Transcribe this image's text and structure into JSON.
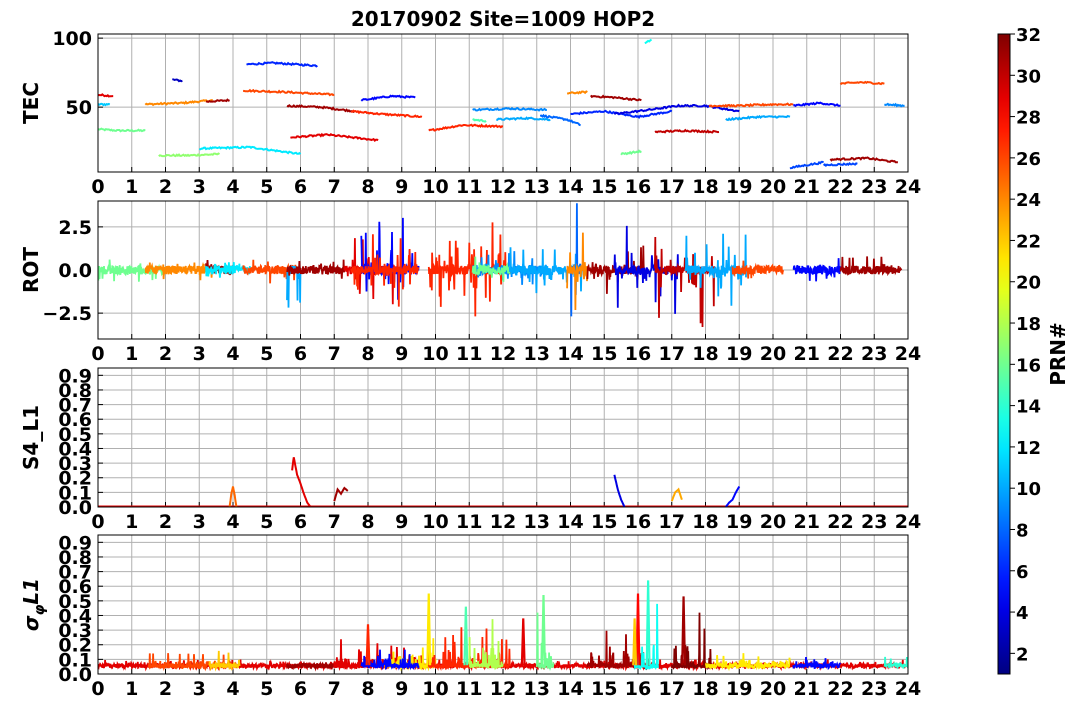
{
  "title": "20170902 Site=1009 HOP2",
  "xticks": [
    "0",
    "1",
    "2",
    "3",
    "4",
    "5",
    "6",
    "7",
    "8",
    "9",
    "10",
    "11",
    "12",
    "13",
    "14",
    "15",
    "16",
    "17",
    "18",
    "19",
    "20",
    "21",
    "22",
    "23",
    "24"
  ],
  "colorbar": {
    "label": "PRN#",
    "ticks": [
      "2",
      "4",
      "6",
      "8",
      "10",
      "12",
      "14",
      "16",
      "18",
      "20",
      "22",
      "24",
      "26",
      "28",
      "30",
      "32"
    ],
    "range": [
      1,
      32
    ]
  },
  "chart_data": [
    {
      "type": "line",
      "ylabel": "TEC",
      "xlim": [
        0,
        24
      ],
      "ylim": [
        3,
        103
      ],
      "yticks": [
        "50",
        "100"
      ],
      "ytick_values": [
        50,
        100
      ],
      "grid": true,
      "series": [
        {
          "prn": 16,
          "x": [
            0.0,
            0.6,
            1.4
          ],
          "y": [
            34,
            33,
            33
          ]
        },
        {
          "prn": 11,
          "x": [
            0.0,
            0.35
          ],
          "y": [
            52,
            52
          ]
        },
        {
          "prn": 29,
          "x": [
            0.0,
            0.45
          ],
          "y": [
            59,
            58
          ]
        },
        {
          "prn": 24,
          "x": [
            1.4,
            2.5,
            3.4
          ],
          "y": [
            52,
            53,
            55
          ]
        },
        {
          "prn": 3,
          "x": [
            2.2,
            2.5
          ],
          "y": [
            70,
            69
          ]
        },
        {
          "prn": 31,
          "x": [
            3.2,
            3.9
          ],
          "y": [
            54,
            55
          ]
        },
        {
          "prn": 17,
          "x": [
            1.8,
            2.7,
            3.6
          ],
          "y": [
            15,
            15,
            16
          ]
        },
        {
          "prn": 12,
          "x": [
            3.0,
            4.5,
            6.0
          ],
          "y": [
            20,
            21,
            16
          ]
        },
        {
          "prn": 6,
          "x": [
            4.4,
            5.2,
            6.5
          ],
          "y": [
            81,
            82,
            80
          ]
        },
        {
          "prn": 26,
          "x": [
            4.3,
            5.5,
            7.0
          ],
          "y": [
            62,
            61,
            59
          ]
        },
        {
          "prn": 31,
          "x": [
            5.6,
            6.6,
            7.6
          ],
          "y": [
            51,
            50,
            47
          ]
        },
        {
          "prn": 27,
          "x": [
            7.5,
            8.4,
            9.6
          ],
          "y": [
            47,
            45,
            43
          ]
        },
        {
          "prn": 29,
          "x": [
            5.7,
            6.8,
            8.3
          ],
          "y": [
            28,
            30,
            26
          ]
        },
        {
          "prn": 5,
          "x": [
            7.8,
            8.7,
            9.4
          ],
          "y": [
            55,
            58,
            57
          ]
        },
        {
          "prn": 27,
          "x": [
            9.8,
            10.8,
            12.0
          ],
          "y": [
            33,
            37,
            36
          ]
        },
        {
          "prn": 9,
          "x": [
            11.1,
            12.2,
            13.3
          ],
          "y": [
            48,
            49,
            48
          ]
        },
        {
          "prn": 15,
          "x": [
            11.1,
            11.5
          ],
          "y": [
            41,
            40
          ]
        },
        {
          "prn": 10,
          "x": [
            11.8,
            12.7,
            13.4
          ],
          "y": [
            41,
            42,
            41
          ]
        },
        {
          "prn": 8,
          "x": [
            13.1,
            13.9,
            14.3
          ],
          "y": [
            44,
            41,
            37
          ]
        },
        {
          "prn": 24,
          "x": [
            13.9,
            14.5
          ],
          "y": [
            60,
            61
          ]
        },
        {
          "prn": 31,
          "x": [
            14.6,
            15.3,
            16.1
          ],
          "y": [
            58,
            57,
            55
          ]
        },
        {
          "prn": 6,
          "x": [
            14.0,
            15.0,
            16.0,
            17.0
          ],
          "y": [
            45,
            47,
            43,
            47
          ]
        },
        {
          "prn": 4,
          "x": [
            15.3,
            16.3,
            17.2,
            18.0,
            19.0
          ],
          "y": [
            45,
            48,
            51,
            51,
            47
          ]
        },
        {
          "prn": 16,
          "x": [
            15.5,
            16.1
          ],
          "y": [
            16,
            18
          ]
        },
        {
          "prn": 13,
          "x": [
            16.2,
            16.4
          ],
          "y": [
            96,
            99
          ]
        },
        {
          "prn": 30,
          "x": [
            16.5,
            17.4,
            18.4
          ],
          "y": [
            32,
            33,
            32
          ]
        },
        {
          "prn": 26,
          "x": [
            18.1,
            19.0,
            20.0,
            20.6
          ],
          "y": [
            51,
            51,
            52,
            52
          ]
        },
        {
          "prn": 10,
          "x": [
            18.6,
            19.6,
            20.5
          ],
          "y": [
            41,
            43,
            43
          ]
        },
        {
          "prn": 5,
          "x": [
            20.6,
            21.4,
            22.0
          ],
          "y": [
            51,
            53,
            51
          ]
        },
        {
          "prn": 26,
          "x": [
            22.0,
            22.6,
            23.3
          ],
          "y": [
            67,
            68,
            67
          ]
        },
        {
          "prn": 9,
          "x": [
            23.3,
            23.9
          ],
          "y": [
            52,
            51
          ]
        },
        {
          "prn": 7,
          "x": [
            20.5,
            21.0,
            21.5
          ],
          "y": [
            6,
            8,
            10
          ]
        },
        {
          "prn": 7,
          "x": [
            21.5,
            22.5
          ],
          "y": [
            8,
            9
          ]
        },
        {
          "prn": 31,
          "x": [
            21.7,
            22.8,
            23.7
          ],
          "y": [
            12,
            13,
            10
          ]
        }
      ]
    },
    {
      "type": "line",
      "ylabel": "ROT",
      "xlim": [
        0,
        24
      ],
      "ylim": [
        -4,
        4
      ],
      "yticks": [
        "−2.5",
        "0.0",
        "2.5"
      ],
      "ytick_values": [
        -2.5,
        0,
        2.5
      ],
      "grid": true,
      "segments": [
        {
          "prn": 16,
          "start": 0.0,
          "end": 2.0,
          "amp": 0.7
        },
        {
          "prn": 24,
          "start": 1.4,
          "end": 3.4,
          "amp": 0.6
        },
        {
          "prn": 31,
          "start": 3.2,
          "end": 4.0,
          "amp": 0.6
        },
        {
          "prn": 12,
          "start": 3.2,
          "end": 4.5,
          "amp": 0.5
        },
        {
          "prn": 26,
          "start": 4.3,
          "end": 6.0,
          "amp": 0.8
        },
        {
          "prn": 10,
          "start": 5.6,
          "end": 6.0,
          "amp": 2.2
        },
        {
          "prn": 31,
          "start": 5.6,
          "end": 7.3,
          "amp": 0.6
        },
        {
          "prn": 29,
          "start": 7.3,
          "end": 8.8,
          "amp": 2.0
        },
        {
          "prn": 5,
          "start": 7.8,
          "end": 9.5,
          "amp": 3.3
        },
        {
          "prn": 27,
          "start": 7.5,
          "end": 9.5,
          "amp": 2.4
        },
        {
          "prn": 27,
          "start": 9.8,
          "end": 12.2,
          "amp": 3.0
        },
        {
          "prn": 9,
          "start": 11.1,
          "end": 13.3,
          "amp": 1.1
        },
        {
          "prn": 16,
          "start": 11.1,
          "end": 12.2,
          "amp": 0.8
        },
        {
          "prn": 10,
          "start": 12.2,
          "end": 14.4,
          "amp": 1.4
        },
        {
          "prn": 8,
          "start": 14.0,
          "end": 14.3,
          "amp": 4.0
        },
        {
          "prn": 24,
          "start": 13.9,
          "end": 14.5,
          "amp": 2.8
        },
        {
          "prn": 31,
          "start": 14.5,
          "end": 16.2,
          "amp": 1.5
        },
        {
          "prn": 4,
          "start": 15.3,
          "end": 17.2,
          "amp": 2.7
        },
        {
          "prn": 30,
          "start": 16.5,
          "end": 18.3,
          "amp": 3.5
        },
        {
          "prn": 10,
          "start": 17.4,
          "end": 19.2,
          "amp": 2.3
        },
        {
          "prn": 26,
          "start": 18.8,
          "end": 20.3,
          "amp": 0.6
        },
        {
          "prn": 5,
          "start": 20.6,
          "end": 22.0,
          "amp": 0.7
        },
        {
          "prn": 31,
          "start": 22.0,
          "end": 23.8,
          "amp": 0.8
        }
      ]
    },
    {
      "type": "line",
      "ylabel": "S4_L1",
      "xlim": [
        0,
        24
      ],
      "ylim": [
        0,
        0.95
      ],
      "yticks": [
        "0.0",
        "0.1",
        "0.2",
        "0.3",
        "0.4",
        "0.5",
        "0.6",
        "0.7",
        "0.8",
        "0.9"
      ],
      "ytick_values": [
        0.0,
        0.1,
        0.2,
        0.3,
        0.4,
        0.5,
        0.6,
        0.7,
        0.8,
        0.9
      ],
      "grid": true,
      "baseline_prn": 29,
      "series": [
        {
          "prn": 25,
          "x": [
            3.9,
            3.95,
            4.0,
            4.05,
            4.1
          ],
          "y": [
            0.0,
            0.09,
            0.14,
            0.08,
            0.0
          ]
        },
        {
          "prn": 29,
          "x": [
            5.75,
            5.8,
            5.9,
            6.0,
            6.1,
            6.2,
            6.3
          ],
          "y": [
            0.25,
            0.34,
            0.22,
            0.16,
            0.09,
            0.03,
            0.0
          ]
        },
        {
          "prn": 31,
          "x": [
            7.0,
            7.1,
            7.2,
            7.3,
            7.4
          ],
          "y": [
            0.04,
            0.12,
            0.09,
            0.13,
            0.11
          ]
        },
        {
          "prn": 4,
          "x": [
            15.3,
            15.4,
            15.5,
            15.6
          ],
          "y": [
            0.22,
            0.12,
            0.05,
            0.0
          ]
        },
        {
          "prn": 23,
          "x": [
            17.0,
            17.1,
            17.2,
            17.3
          ],
          "y": [
            0.04,
            0.1,
            0.12,
            0.05
          ]
        },
        {
          "prn": 5,
          "x": [
            18.6,
            18.7,
            18.8,
            18.9,
            19.0
          ],
          "y": [
            0.0,
            0.03,
            0.05,
            0.1,
            0.14
          ]
        }
      ]
    },
    {
      "type": "line",
      "ylabel": "σφL1",
      "ylabel_main": "σ",
      "ylabel_sub": "φ",
      "ylabel_tail": "L1",
      "xlim": [
        0,
        24
      ],
      "ylim": [
        0,
        0.95
      ],
      "yticks": [
        "0.0",
        "0.1",
        "0.2",
        "0.3",
        "0.4",
        "0.5",
        "0.6",
        "0.7",
        "0.8",
        "0.9"
      ],
      "ytick_values": [
        0.0,
        0.1,
        0.2,
        0.3,
        0.4,
        0.5,
        0.6,
        0.7,
        0.8,
        0.9
      ],
      "grid": true,
      "segments": [
        {
          "prn": 29,
          "start": 0.0,
          "end": 24.0,
          "amp": 0.05
        },
        {
          "prn": 26,
          "start": 1.5,
          "end": 4.0,
          "amp": 0.1
        },
        {
          "prn": 22,
          "start": 3.3,
          "end": 4.2,
          "amp": 0.12
        },
        {
          "prn": 31,
          "start": 5.6,
          "end": 7.0,
          "amp": 0.06
        },
        {
          "prn": 29,
          "start": 7.0,
          "end": 9.8,
          "amp": 0.2
        },
        {
          "prn": 21,
          "start": 8.5,
          "end": 10.0,
          "amp": 0.2
        },
        {
          "prn": 5,
          "start": 7.8,
          "end": 9.5,
          "amp": 0.14
        },
        {
          "prn": 27,
          "start": 9.8,
          "end": 12.2,
          "amp": 0.28
        },
        {
          "prn": 18,
          "start": 11.0,
          "end": 12.0,
          "amp": 0.35
        },
        {
          "prn": 16,
          "start": 13.0,
          "end": 13.5,
          "amp": 0.4
        },
        {
          "prn": 31,
          "start": 14.5,
          "end": 16.3,
          "amp": 0.25
        },
        {
          "prn": 13,
          "start": 15.9,
          "end": 16.6,
          "amp": 0.5
        },
        {
          "prn": 32,
          "start": 17.0,
          "end": 18.2,
          "amp": 0.38
        },
        {
          "prn": 21,
          "start": 18.0,
          "end": 20.5,
          "amp": 0.12
        },
        {
          "prn": 5,
          "start": 20.6,
          "end": 22.0,
          "amp": 0.07
        },
        {
          "prn": 14,
          "start": 23.3,
          "end": 24.0,
          "amp": 0.07
        }
      ],
      "spikes": [
        {
          "prn": 21,
          "x": 9.8,
          "y": 0.55
        },
        {
          "prn": 16,
          "x": 13.2,
          "y": 0.54
        },
        {
          "prn": 15,
          "x": 10.9,
          "y": 0.46
        },
        {
          "prn": 28,
          "x": 16.0,
          "y": 0.55
        },
        {
          "prn": 14,
          "x": 16.3,
          "y": 0.64
        },
        {
          "prn": 31,
          "x": 17.35,
          "y": 0.53
        },
        {
          "prn": 29,
          "x": 12.6,
          "y": 0.38
        },
        {
          "prn": 27,
          "x": 8.0,
          "y": 0.34
        },
        {
          "prn": 22,
          "x": 15.9,
          "y": 0.38
        }
      ]
    }
  ]
}
